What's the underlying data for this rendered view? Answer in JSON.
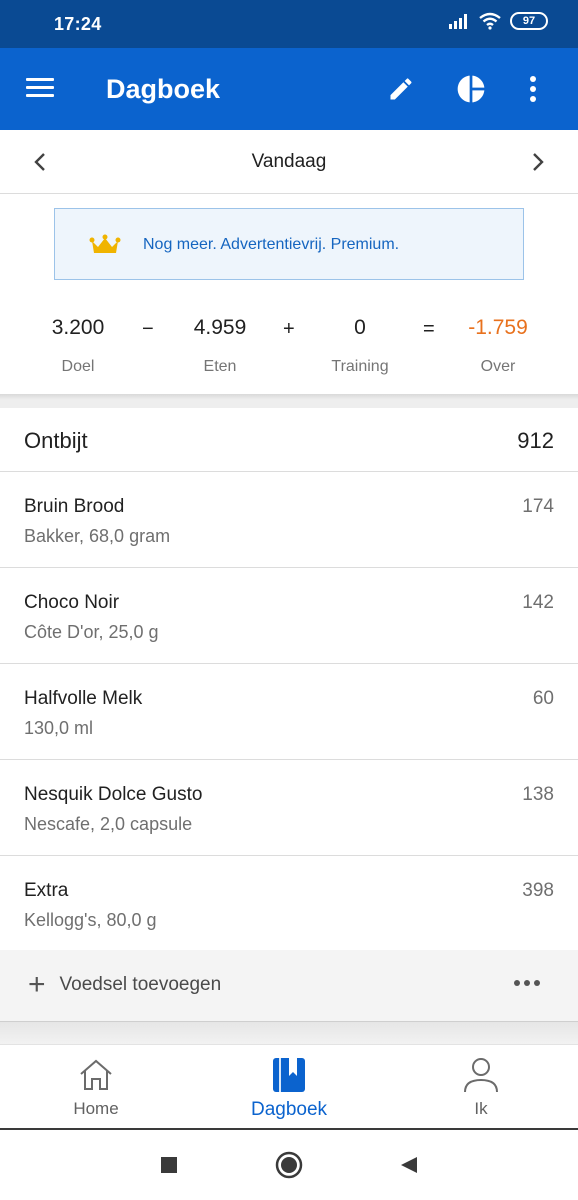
{
  "status_bar": {
    "time": "17:24",
    "battery": "97"
  },
  "app_bar": {
    "title": "Dagboek",
    "icons": [
      "menu-icon",
      "edit-icon",
      "pie-chart-icon",
      "more-vert-icon"
    ]
  },
  "date_nav": {
    "label": "Vandaag"
  },
  "premium_banner": {
    "text": "Nog meer. Advertentievrij. Premium."
  },
  "summary": {
    "goal": {
      "value": "3.200",
      "label": "Doel"
    },
    "op_minus": "−",
    "food": {
      "value": "4.959",
      "label": "Eten"
    },
    "op_plus": "+",
    "exercise": {
      "value": "0",
      "label": "Training"
    },
    "op_equals": "=",
    "remaining": {
      "value": "-1.759",
      "label": "Over"
    }
  },
  "colors": {
    "appbar": "#0b63ce",
    "statusbar": "#0a4a93",
    "over": "#e8711d",
    "accent": "#0b63ce"
  },
  "meal": {
    "name": "Ontbijt",
    "total": "912",
    "items": [
      {
        "name": "Bruin Brood",
        "desc": "Bakker, 68,0 gram",
        "cal": "174"
      },
      {
        "name": "Choco Noir",
        "desc": "Côte D'or, 25,0 g",
        "cal": "142"
      },
      {
        "name": "Halfvolle Melk",
        "desc": "130,0 ml",
        "cal": "60"
      },
      {
        "name": "Nesquik Dolce Gusto",
        "desc": "Nescafe, 2,0 capsule",
        "cal": "138"
      },
      {
        "name": "Extra",
        "desc": "Kellogg's, 80,0 g",
        "cal": "398"
      }
    ],
    "add_label": "Voedsel toevoegen"
  },
  "bottom_nav": {
    "tabs": [
      {
        "label": "Home",
        "icon": "home-icon"
      },
      {
        "label": "Dagboek",
        "icon": "diary-icon",
        "active": true
      },
      {
        "label": "Ik",
        "icon": "person-icon"
      }
    ]
  }
}
